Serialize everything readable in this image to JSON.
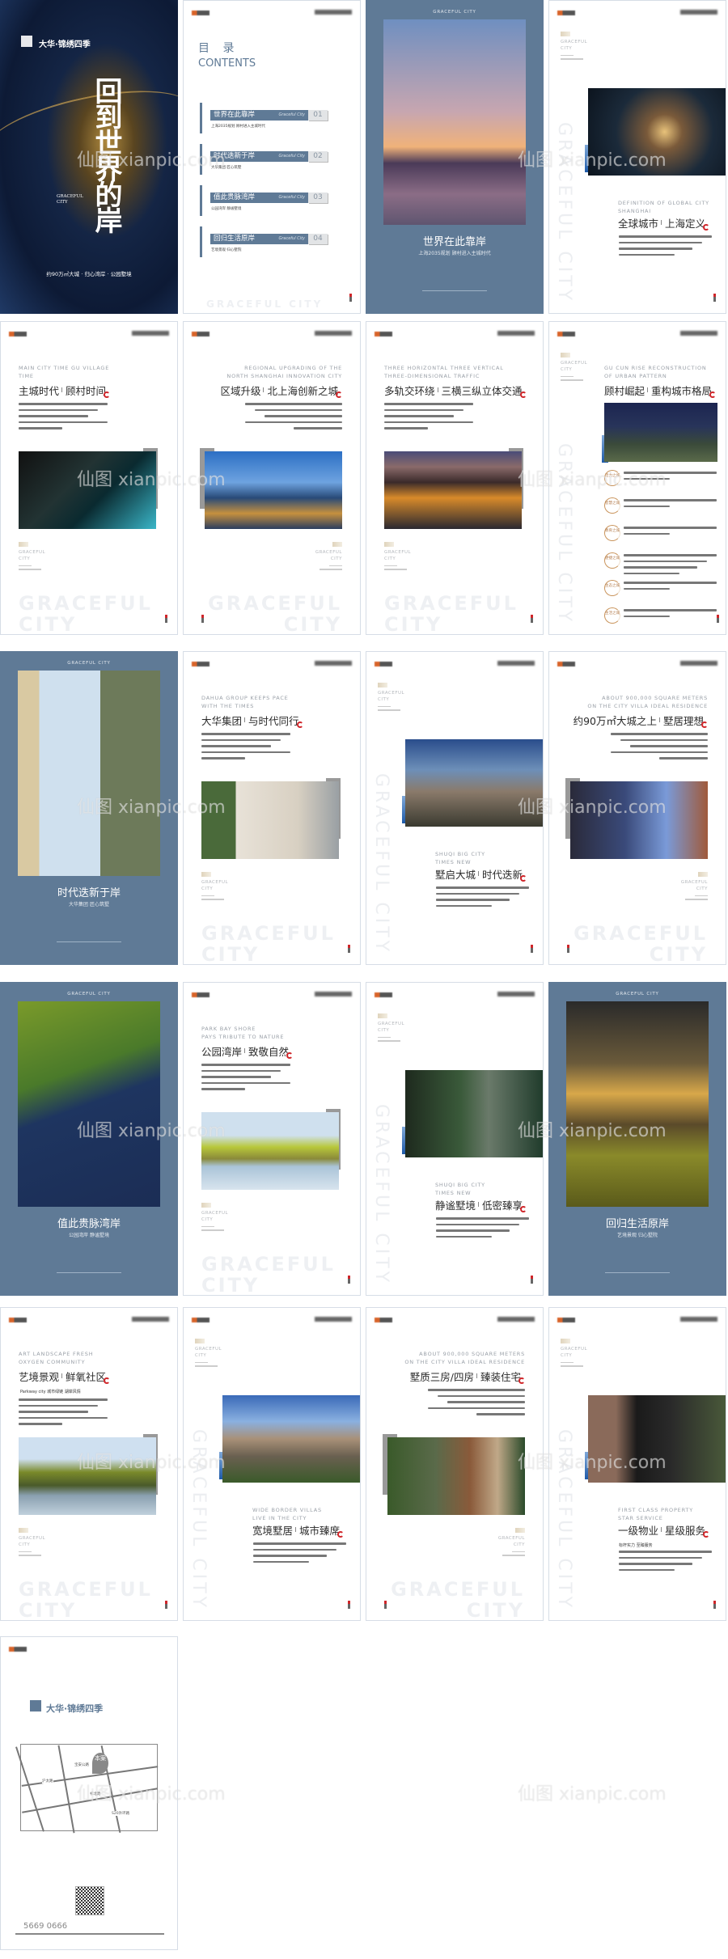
{
  "watermark": "仙图 xianpic.com",
  "common": {
    "graceful_city": "GRACEFUL CITY",
    "graceful": "GRACEFUL",
    "city": "CITY"
  },
  "brand": {
    "project_logo": "大华·锦绣四季",
    "developer_logo": "大华集团"
  },
  "accent_colors": {
    "blue_panel": "#5f7a96",
    "red_ring": "#d0262a",
    "gold": "#c9935a"
  },
  "pages": [
    {
      "kind": "cover",
      "title": "回到世界的岸",
      "title_en": "GRACEFUL CITY",
      "tagline": "约90万㎡大城 · 归心湾岸 · 公园墅境"
    },
    {
      "kind": "contents",
      "heading_cn": "目 录",
      "heading_en": "CONTENTS",
      "script": "Graceful City",
      "items": [
        {
          "title": "世界在此靠岸",
          "number": "01",
          "subtitle": "上海2035规划 顾村进入主城时代"
        },
        {
          "kind": "",
          "title": "时代迭新于岸",
          "number": "02",
          "subtitle": "大华集团 匠心筑墅"
        },
        {
          "title": "值此贵脉湾岸",
          "number": "03",
          "subtitle": "公园湾岸 静谧墅境"
        },
        {
          "title": "回归生活原岸",
          "number": "04",
          "subtitle": "艺境景观 归心墅院"
        }
      ]
    },
    {
      "kind": "section",
      "header": "GRACEFUL CITY",
      "title": "世界在此靠岸",
      "subtitle": "上海2035规划  顾村进入主城时代"
    },
    {
      "kind": "feature",
      "en": [
        "DEFINITION OF GLOBAL CITY",
        "SHANGHAI"
      ],
      "title_a": "全球城市",
      "title_b": "上海定义"
    },
    {
      "kind": "article",
      "en": [
        "MAIN CITY TIME GU VILLAGE",
        "TIME"
      ],
      "title_a": "主城时代",
      "title_b": "顾村时间"
    },
    {
      "kind": "article",
      "en": [
        "REGIONAL UPGRADING OF THE",
        "NORTH SHANGHAI INNOVATION CITY"
      ],
      "title_a": "区域升级",
      "title_b": "北上海创新之城"
    },
    {
      "kind": "article",
      "en": [
        "THREE HORIZONTAL THREE VERTICAL",
        "THREE-DIMENSIONAL TRAFFIC"
      ],
      "title_a": "多轨交环绕",
      "title_b": "三横三纵立体交通"
    },
    {
      "kind": "list",
      "en": [
        "GU CUN RISE RECONSTRUCTION",
        "OF URBAN PATTERN"
      ],
      "title_a": "顾村崛起",
      "title_b": "重构城市格局",
      "badges": [
        "活力之城",
        "智慧之城",
        "教育之城",
        "便捷之城",
        "生态之城",
        "生活之城"
      ]
    },
    {
      "kind": "section",
      "header": "GRACEFUL CITY",
      "title": "时代迭新于岸",
      "subtitle": "大华集团  匠心筑墅"
    },
    {
      "kind": "article",
      "en": [
        "DAHUA GROUP KEEPS PACE",
        "WITH THE TIMES"
      ],
      "title_a": "大华集团",
      "title_b": "与时代同行"
    },
    {
      "kind": "feature",
      "en": [
        "SHUQI BIG CITY",
        "TIMES NEW"
      ],
      "title_a": "墅启大城",
      "title_b": "时代迭新"
    },
    {
      "kind": "article",
      "en": [
        "ABOUT 900,000 SQUARE METERS",
        "ON THE CITY VILLA IDEAL RESIDENCE"
      ],
      "title_a": "约90万㎡大城之上",
      "title_b": "墅居理想"
    },
    {
      "kind": "section",
      "header": "GRACEFUL CITY",
      "title": "值此贵脉湾岸",
      "subtitle": "公园湾岸  静谧墅境"
    },
    {
      "kind": "article",
      "en": [
        "PARK BAY SHORE",
        "PAYS TRIBUTE TO NATURE"
      ],
      "title_a": "公园湾岸",
      "title_b": "致敬自然"
    },
    {
      "kind": "feature",
      "en": [
        "SHUQI BIG CITY",
        "TIMES NEW"
      ],
      "title_a": "静谧墅境",
      "title_b": "低密臻享"
    },
    {
      "kind": "section",
      "header": "GRACEFUL CITY",
      "title": "回归生活原岸",
      "subtitle": "艺境景观  归心墅院"
    },
    {
      "kind": "article",
      "en": [
        "ART LANDSCAPE FRESH",
        "OXYGEN COMMUNITY"
      ],
      "title_a": "艺境景观",
      "title_b": "鲜氧社区",
      "lead": "Parkway city 城市绿链 湖岸风情"
    },
    {
      "kind": "feature",
      "en": [
        "WIDE BORDER VILLAS",
        "LIVE IN THE CITY"
      ],
      "title_a": "宽境墅居",
      "title_b": "城市臻席"
    },
    {
      "kind": "article",
      "en": [
        "ABOUT 900,000 SQUARE METERS",
        "ON THE CITY VILLA IDEAL RESIDENCE"
      ],
      "title_a": "墅质三房/四房",
      "title_b": "臻装住宅"
    },
    {
      "kind": "feature",
      "en": [
        "FIRST CLASS PROPERTY",
        "STAR SERVICE"
      ],
      "title_a": "一级物业",
      "title_b": "星级服务",
      "lead": "标杆实力 至臻服务"
    },
    {
      "kind": "back",
      "map_marker": "本案",
      "roads": [
        "沪太路",
        "宝安公路",
        "S20外环路",
        "祁北路"
      ],
      "phone": "5669 0666"
    }
  ]
}
